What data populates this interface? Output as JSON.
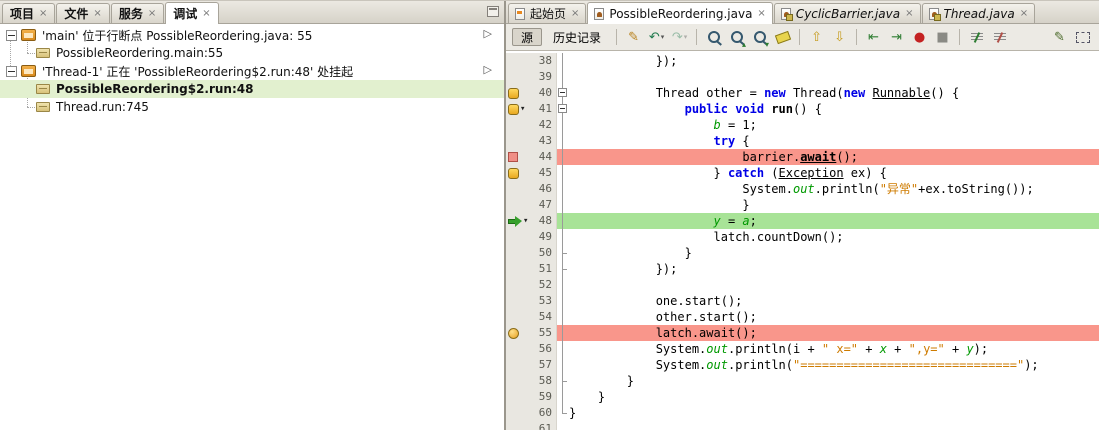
{
  "ui": {
    "icons": {
      "close": "×",
      "resume": "▷",
      "annotation_arrow": "▾"
    },
    "colors": {
      "breakpoint_line": "#f9968b",
      "current_line": "#a8e397",
      "selected_thread_row": "#e2f0cf",
      "keyword": "#0000e6",
      "string": "#ce7b00",
      "field": "#009900"
    }
  },
  "left_panel": {
    "tabs": [
      {
        "id": "projects",
        "label": "项目"
      },
      {
        "id": "files",
        "label": "文件"
      },
      {
        "id": "services",
        "label": "服务"
      },
      {
        "id": "debug",
        "label": "调试",
        "active": true
      }
    ],
    "tree": [
      {
        "id": "thread-main",
        "icon": "thread",
        "label": "'main' 位于行断点 PossibleReordering.java: 55",
        "resume": true
      },
      {
        "child": true,
        "icon": "frame",
        "label": "PossibleReordering.main:55"
      },
      {
        "id": "thread-1",
        "icon": "thread",
        "label": "'Thread-1' 正在 'PossibleReordering$2.run:48' 处挂起",
        "resume": true
      },
      {
        "child": true,
        "icon": "frame",
        "label": "PossibleReordering$2.run:48",
        "bold": true,
        "selected": true
      },
      {
        "child": true,
        "icon": "frame",
        "label": "Thread.run:745"
      }
    ]
  },
  "editor": {
    "tabs": [
      {
        "id": "start-page",
        "label": "起始页",
        "icon": "page"
      },
      {
        "id": "possible-reordering",
        "label": "PossibleReordering.java",
        "icon": "java",
        "active": true
      },
      {
        "id": "cyclic-barrier",
        "label": "CyclicBarrier.java",
        "icon": "java",
        "lock": true,
        "readonly": true
      },
      {
        "id": "thread",
        "label": "Thread.java",
        "icon": "java",
        "lock": true,
        "readonly": true
      }
    ],
    "toolbar": {
      "source_label": "源",
      "history_label": "历史记录",
      "icons": [
        {
          "name": "last-edit-position-icon",
          "type": "glyph",
          "glyph": "✎",
          "color": "#b8811b"
        },
        {
          "name": "back-icon",
          "type": "glyph",
          "glyph": "↶",
          "color": "#1f7a4d",
          "dropdown": true
        },
        {
          "name": "forward-icon",
          "type": "glyph",
          "glyph": "↷",
          "color": "#1f7a4d",
          "dropdown": true,
          "disabled": true
        },
        {
          "sep": true
        },
        {
          "name": "find-selection-icon",
          "type": "mag"
        },
        {
          "name": "find-previous-occurrence-icon",
          "type": "mag",
          "arrow": "up"
        },
        {
          "name": "find-next-occurrence-icon",
          "type": "mag",
          "arrow": "down"
        },
        {
          "name": "toggle-highlight-search-icon",
          "type": "highlighter"
        },
        {
          "sep": true
        },
        {
          "name": "previous-bookmark-icon",
          "type": "glyph",
          "glyph": "⇧",
          "color": "#c69c1e"
        },
        {
          "name": "next-bookmark-icon",
          "type": "glyph",
          "glyph": "⇩",
          "color": "#c69c1e"
        },
        {
          "sep": true
        },
        {
          "name": "shift-line-left-icon",
          "type": "glyph",
          "glyph": "⇤",
          "color": "#2e7d32"
        },
        {
          "name": "shift-line-right-icon",
          "type": "glyph",
          "glyph": "⇥",
          "color": "#2e7d32"
        },
        {
          "name": "start-macro-recording-icon",
          "type": "glyph",
          "glyph": "●",
          "color": "#c42222"
        },
        {
          "name": "stop-macro-recording-icon",
          "type": "glyph",
          "glyph": "■",
          "color": "#8a8a84"
        },
        {
          "sep": true
        },
        {
          "name": "comment-icon",
          "type": "lines",
          "accent": "#2e7d32"
        },
        {
          "name": "uncomment-icon",
          "type": "lines",
          "accent": "#b05048"
        }
      ],
      "right_icons": [
        {
          "name": "jump-to-last-edit-icon",
          "type": "glyph",
          "glyph": "✎",
          "color": "#4a6a2a"
        },
        {
          "name": "toggle-rectangular-selection-icon",
          "type": "rect"
        }
      ]
    },
    "lines": [
      {
        "n": 38,
        "fold": "bar",
        "seg": [
          [
            "p",
            "            });"
          ]
        ]
      },
      {
        "n": 39,
        "fold": "bar",
        "seg": []
      },
      {
        "n": 40,
        "fold": "box",
        "icons": [
          "yellow-badge"
        ],
        "seg": [
          [
            "p",
            "            Thread other = "
          ],
          [
            "k",
            "new"
          ],
          [
            "p",
            " Thread("
          ],
          [
            "k",
            "new"
          ],
          [
            "p",
            " "
          ],
          [
            "u",
            "Runnable"
          ],
          [
            "p",
            "() {"
          ]
        ]
      },
      {
        "n": 41,
        "fold": "box",
        "icons": [
          "yellow-badge",
          "down-arrow"
        ],
        "seg": [
          [
            "p",
            "                "
          ],
          [
            "k",
            "public"
          ],
          [
            "p",
            " "
          ],
          [
            "k",
            "void"
          ],
          [
            "p",
            " "
          ],
          [
            "m",
            "run"
          ],
          [
            "p",
            "() {"
          ]
        ]
      },
      {
        "n": 42,
        "fold": "bar",
        "seg": [
          [
            "p",
            "                    "
          ],
          [
            "f",
            "b"
          ],
          [
            "p",
            " = 1;"
          ]
        ]
      },
      {
        "n": 43,
        "fold": "bar",
        "seg": [
          [
            "p",
            "                    "
          ],
          [
            "k",
            "try"
          ],
          [
            "p",
            " {"
          ]
        ]
      },
      {
        "n": 44,
        "fold": "bar",
        "hl": "red",
        "icons": [
          "red-square"
        ],
        "seg": [
          [
            "p",
            "                        barrier."
          ],
          [
            "m u",
            "await"
          ],
          [
            "p",
            "();"
          ]
        ]
      },
      {
        "n": 45,
        "fold": "bar",
        "icons": [
          "yellow-badge"
        ],
        "seg": [
          [
            "p",
            "                    } "
          ],
          [
            "k",
            "catch"
          ],
          [
            "p",
            " ("
          ],
          [
            "u",
            "Exception"
          ],
          [
            "p",
            " ex) {"
          ]
        ]
      },
      {
        "n": 46,
        "fold": "bar",
        "seg": [
          [
            "p",
            "                        System."
          ],
          [
            "f",
            "out"
          ],
          [
            "p",
            ".println("
          ],
          [
            "s",
            "\"异常\""
          ],
          [
            "p",
            "+ex.toString());"
          ]
        ]
      },
      {
        "n": 47,
        "fold": "bar",
        "seg": [
          [
            "p",
            "                        }"
          ]
        ]
      },
      {
        "n": 48,
        "fold": "bar",
        "hl": "green",
        "icons": [
          "green-arrow",
          "down-arrow"
        ],
        "seg": [
          [
            "p",
            "                    "
          ],
          [
            "f",
            "y"
          ],
          [
            "p",
            " = "
          ],
          [
            "f",
            "a"
          ],
          [
            "p",
            ";"
          ]
        ]
      },
      {
        "n": 49,
        "fold": "bar",
        "seg": [
          [
            "p",
            "                    latch.countDown();"
          ]
        ]
      },
      {
        "n": 50,
        "fold": "end",
        "seg": [
          [
            "p",
            "                }"
          ]
        ]
      },
      {
        "n": 51,
        "fold": "end",
        "seg": [
          [
            "p",
            "            });"
          ]
        ]
      },
      {
        "n": 52,
        "fold": "bar",
        "seg": []
      },
      {
        "n": 53,
        "fold": "bar",
        "seg": [
          [
            "p",
            "            one.start();"
          ]
        ]
      },
      {
        "n": 54,
        "fold": "bar",
        "seg": [
          [
            "p",
            "            other.start();"
          ]
        ]
      },
      {
        "n": 55,
        "fold": "bar",
        "hl": "red",
        "icons": [
          "yellow-circle"
        ],
        "seg": [
          [
            "p",
            "            latch.await();"
          ]
        ]
      },
      {
        "n": 56,
        "fold": "bar",
        "seg": [
          [
            "p",
            "            System."
          ],
          [
            "f",
            "out"
          ],
          [
            "p",
            ".println(i + "
          ],
          [
            "s",
            "\" x=\""
          ],
          [
            "p",
            " + "
          ],
          [
            "f",
            "x"
          ],
          [
            "p",
            " + "
          ],
          [
            "s",
            "\",y=\""
          ],
          [
            "p",
            " + "
          ],
          [
            "f",
            "y"
          ],
          [
            "p",
            ");"
          ]
        ]
      },
      {
        "n": 57,
        "fold": "bar",
        "seg": [
          [
            "p",
            "            System."
          ],
          [
            "f",
            "out"
          ],
          [
            "p",
            ".println("
          ],
          [
            "s",
            "\"==============================\""
          ],
          [
            "p",
            ");"
          ]
        ]
      },
      {
        "n": 58,
        "fold": "end",
        "seg": [
          [
            "p",
            "        }"
          ]
        ]
      },
      {
        "n": 59,
        "fold": "bar",
        "seg": [
          [
            "p",
            "    }"
          ]
        ]
      },
      {
        "n": 60,
        "fold": "endlast",
        "seg": [
          [
            "p",
            "}"
          ]
        ]
      },
      {
        "n": 61,
        "seg": []
      }
    ]
  }
}
